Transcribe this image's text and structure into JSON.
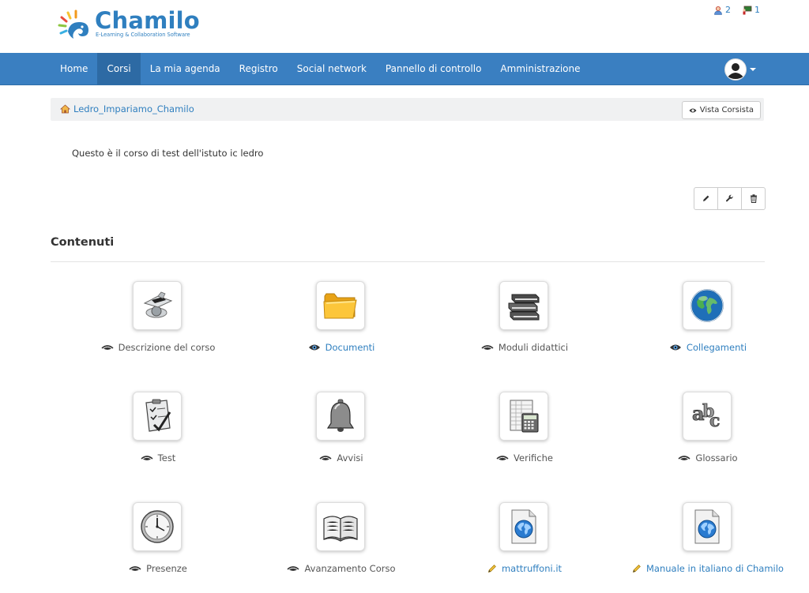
{
  "header": {
    "logo_text": "Chamilo",
    "logo_subtitle": "E-Learning & Collaboration Software",
    "stats": [
      {
        "icon": "users-online-icon",
        "value": "2"
      },
      {
        "icon": "classroom-icon",
        "value": "1"
      }
    ]
  },
  "navbar": {
    "items": [
      {
        "label": "Home",
        "active": false
      },
      {
        "label": "Corsi",
        "active": true
      },
      {
        "label": "La mia agenda",
        "active": false
      },
      {
        "label": "Registro",
        "active": false
      },
      {
        "label": "Social network",
        "active": false
      },
      {
        "label": "Pannello di controllo",
        "active": false
      },
      {
        "label": "Amministrazione",
        "active": false
      }
    ]
  },
  "breadcrumb": {
    "course": "Ledro_Impariamo_Chamilo",
    "student_view": "Vista Corsista"
  },
  "course": {
    "description": "Questo è il corso di test dell'istuto ic ledro"
  },
  "content": {
    "title": "Contenuti",
    "tools": [
      {
        "label": "Descrizione del corso",
        "icon": "course-description-icon",
        "visibility": "hidden"
      },
      {
        "label": "Documenti",
        "icon": "folder-icon",
        "visibility": "visible"
      },
      {
        "label": "Moduli didattici",
        "icon": "books-icon",
        "visibility": "hidden"
      },
      {
        "label": "Collegamenti",
        "icon": "globe-icon",
        "visibility": "visible"
      },
      {
        "label": "Test",
        "icon": "quiz-icon",
        "visibility": "hidden"
      },
      {
        "label": "Avvisi",
        "icon": "bell-icon",
        "visibility": "hidden"
      },
      {
        "label": "Verifiche",
        "icon": "calculator-icon",
        "visibility": "hidden"
      },
      {
        "label": "Glossario",
        "icon": "glossary-abc-icon",
        "visibility": "hidden"
      },
      {
        "label": "Presenze",
        "icon": "clock-icon",
        "visibility": "hidden"
      },
      {
        "label": "Avanzamento Corso",
        "icon": "open-book-icon",
        "visibility": "hidden"
      },
      {
        "label": "mattruffoni.it",
        "icon": "web-link-icon",
        "visibility": "link"
      },
      {
        "label": "Manuale in italiano di Chamilo",
        "icon": "web-link-icon",
        "visibility": "link"
      }
    ]
  }
}
